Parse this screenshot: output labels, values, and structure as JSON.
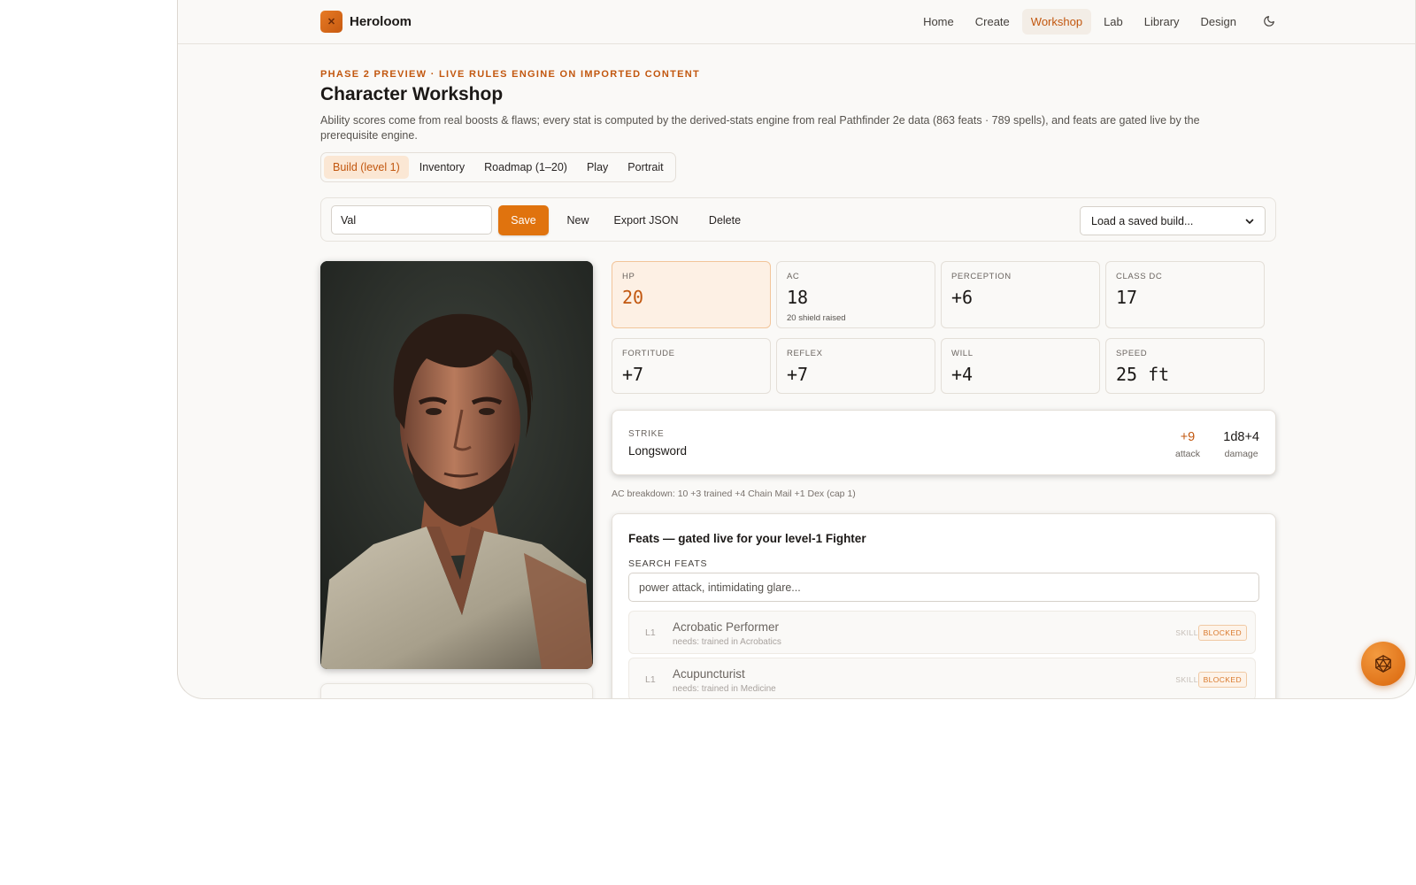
{
  "app": {
    "name": "Heroloom"
  },
  "nav": {
    "items": [
      "Home",
      "Create",
      "Workshop",
      "Lab",
      "Library",
      "Design"
    ],
    "active": "Workshop"
  },
  "header": {
    "eyebrow": "PHASE 2 PREVIEW · LIVE RULES ENGINE ON IMPORTED CONTENT",
    "title": "Character Workshop",
    "subtitle": "Ability scores come from real boosts & flaws; every stat is computed by the derived-stats engine from real Pathfinder 2e data (863 feats · 789 spells), and feats are gated live by the prerequisite engine."
  },
  "tabs": [
    {
      "label": "Build (level 1)",
      "active": true
    },
    {
      "label": "Inventory",
      "active": false
    },
    {
      "label": "Roadmap (1–20)",
      "active": false
    },
    {
      "label": "Play",
      "active": false
    },
    {
      "label": "Portrait",
      "active": false
    }
  ],
  "toolbar": {
    "name_value": "Val",
    "save_label": "Save",
    "new_label": "New",
    "export_label": "Export JSON",
    "delete_label": "Delete",
    "load_select": "Load a saved build..."
  },
  "stats": [
    {
      "label": "HP",
      "value": "20",
      "note": ""
    },
    {
      "label": "AC",
      "value": "18",
      "note": "20 shield raised"
    },
    {
      "label": "PERCEPTION",
      "value": "+6",
      "note": ""
    },
    {
      "label": "CLASS DC",
      "value": "17",
      "note": ""
    },
    {
      "label": "FORTITUDE",
      "value": "+7",
      "note": ""
    },
    {
      "label": "REFLEX",
      "value": "+7",
      "note": ""
    },
    {
      "label": "WILL",
      "value": "+4",
      "note": ""
    },
    {
      "label": "SPEED",
      "value": "25 ft",
      "note": ""
    }
  ],
  "strike": {
    "label": "STRIKE",
    "name": "Longsword",
    "attack": "+9",
    "attack_label": "attack",
    "damage": "1d8+4",
    "damage_label": "damage"
  },
  "ac_breakdown": "AC breakdown: 10 +3 trained +4 Chain Mail +1 Dex (cap 1)",
  "feats": {
    "title": "Feats — gated live for your level-1 Fighter",
    "search_label": "SEARCH FEATS",
    "search_placeholder": "power attack, intimidating glare...",
    "items": [
      {
        "level": "L1",
        "name": "Acrobatic Performer",
        "need": "needs: trained in Acrobatics",
        "tag": "SKILL",
        "status": "BLOCKED"
      },
      {
        "level": "L1",
        "name": "Acupuncturist",
        "need": "needs: trained in Medicine",
        "tag": "SKILL",
        "status": "BLOCKED"
      }
    ]
  },
  "colors": {
    "accent": "#e0730e",
    "accent_text": "#c2570f",
    "hp_bg": "#fdf0e4"
  },
  "icons": {
    "logo": "swords-logo-icon",
    "theme": "moon-icon",
    "fab": "d20-dice-icon",
    "select": "chevron-down-icon"
  }
}
